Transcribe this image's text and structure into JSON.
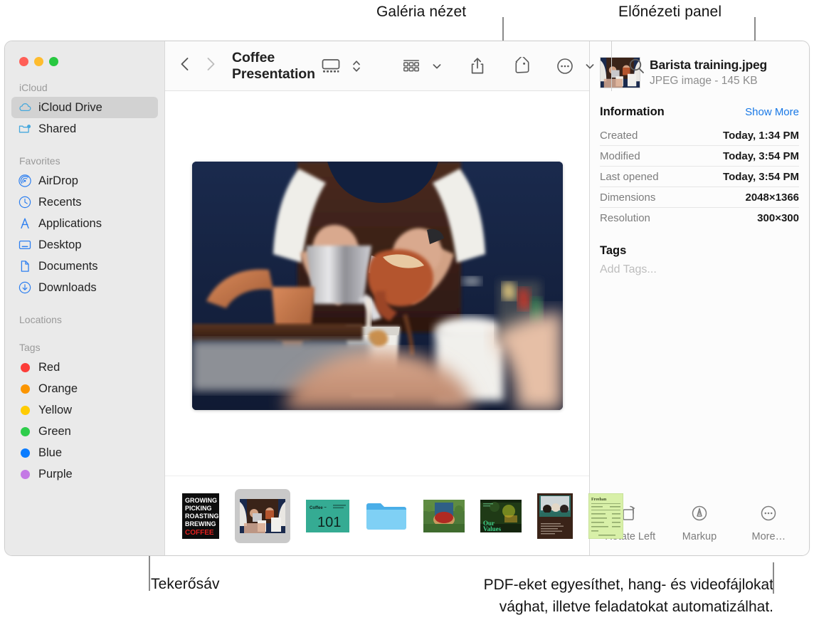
{
  "annotations": {
    "gallery_view": "Galéria nézet",
    "preview_panel": "Előnézeti panel",
    "scrollbar": "Tekerősáv",
    "bottom_line1": "PDF-eket egyesíthet, hang- és videofájlokat",
    "bottom_line2": "vághat, illetve feladatokat automatizálhat."
  },
  "window": {
    "title": "Coffee Presentation",
    "traffic_lights": [
      {
        "name": "close",
        "color": "#ff5f57"
      },
      {
        "name": "minimize",
        "color": "#febc2e"
      },
      {
        "name": "zoom",
        "color": "#28c840"
      }
    ]
  },
  "toolbar": {
    "back_icon": "chevron-left-icon",
    "forward_icon": "chevron-right-icon",
    "view_gallery_icon": "gallery-view-icon",
    "view_stepper_icon": "chevron-up-down-icon",
    "group_icon": "group-items-icon",
    "group_chevron_icon": "chevron-down-icon",
    "share_icon": "share-icon",
    "tag_icon": "tag-icon",
    "more_icon": "ellipsis-circle-icon",
    "more_chevron_icon": "chevron-down-icon",
    "search_icon": "search-icon"
  },
  "sidebar": {
    "sections": [
      {
        "title": "iCloud",
        "items": [
          {
            "label": "iCloud Drive",
            "icon": "icloud-icon",
            "selected": true,
            "color": "#3aa0dd"
          },
          {
            "label": "Shared",
            "icon": "shared-folder-icon",
            "selected": false,
            "color": "#3aa0dd"
          }
        ]
      },
      {
        "title": "Favorites",
        "items": [
          {
            "label": "AirDrop",
            "icon": "airdrop-icon",
            "selected": false,
            "color": "#2d7ff0"
          },
          {
            "label": "Recents",
            "icon": "clock-icon",
            "selected": false,
            "color": "#2d7ff0"
          },
          {
            "label": "Applications",
            "icon": "applications-icon",
            "selected": false,
            "color": "#2d7ff0"
          },
          {
            "label": "Desktop",
            "icon": "desktop-icon",
            "selected": false,
            "color": "#2d7ff0"
          },
          {
            "label": "Documents",
            "icon": "document-icon",
            "selected": false,
            "color": "#2d7ff0"
          },
          {
            "label": "Downloads",
            "icon": "downloads-icon",
            "selected": false,
            "color": "#2d7ff0"
          }
        ]
      },
      {
        "title": "Locations",
        "items": []
      },
      {
        "title": "Tags",
        "items": [
          {
            "label": "Red",
            "icon": "tag-dot-icon",
            "selected": false,
            "color": "#fc3d39"
          },
          {
            "label": "Orange",
            "icon": "tag-dot-icon",
            "selected": false,
            "color": "#fb9500"
          },
          {
            "label": "Yellow",
            "icon": "tag-dot-icon",
            "selected": false,
            "color": "#ffcc02"
          },
          {
            "label": "Green",
            "icon": "tag-dot-icon",
            "selected": false,
            "color": "#2ecd4b"
          },
          {
            "label": "Blue",
            "icon": "tag-dot-icon",
            "selected": false,
            "color": "#0a7cff"
          },
          {
            "label": "Purple",
            "icon": "tag-dot-icon",
            "selected": false,
            "color": "#c47ae5"
          }
        ]
      }
    ]
  },
  "gallery": {
    "hero_alt": "Barista pouring coffee into a cup",
    "thumbnails": [
      {
        "name": "growing-picking-roasting-brewing-coffee-poster",
        "selected": false,
        "lines": [
          "GROWING",
          "PICKING",
          "ROASTING",
          "BREWING"
        ],
        "accent_line": "COFFEE"
      },
      {
        "name": "barista-training-photo",
        "selected": true
      },
      {
        "name": "coffee-101-slide",
        "selected": false,
        "heading": "Coffee ~",
        "number": "101"
      },
      {
        "name": "blue-folder",
        "selected": false
      },
      {
        "name": "coffee-cherries-basket-photo",
        "selected": false
      },
      {
        "name": "our-values-slide",
        "selected": false,
        "title": "Our\nValues"
      },
      {
        "name": "meeting-document",
        "selected": false
      },
      {
        "name": "green-invoice-document",
        "selected": false,
        "heading": "Freehan"
      }
    ]
  },
  "preview": {
    "file_name": "Barista training.jpeg",
    "file_kind": "JPEG image - 145 KB",
    "information_title": "Information",
    "show_more": "Show More",
    "rows": [
      {
        "label": "Created",
        "value": "Today, 1:34 PM"
      },
      {
        "label": "Modified",
        "value": "Today, 3:54 PM"
      },
      {
        "label": "Last opened",
        "value": "Today, 3:54 PM"
      },
      {
        "label": "Dimensions",
        "value": "2048×1366"
      },
      {
        "label": "Resolution",
        "value": "300×300"
      }
    ],
    "tags_title": "Tags",
    "add_tags_placeholder": "Add Tags...",
    "actions": [
      {
        "label": "Rotate Left",
        "icon": "rotate-left-icon"
      },
      {
        "label": "Markup",
        "icon": "markup-icon"
      },
      {
        "label": "More…",
        "icon": "ellipsis-circle-icon"
      }
    ]
  },
  "colors": {
    "accent_blue": "#1878e6",
    "sidebar_bg": "#eaeaea",
    "selection_bg": "#d2d2d2",
    "toolbar_bg": "#fbfbfb"
  }
}
